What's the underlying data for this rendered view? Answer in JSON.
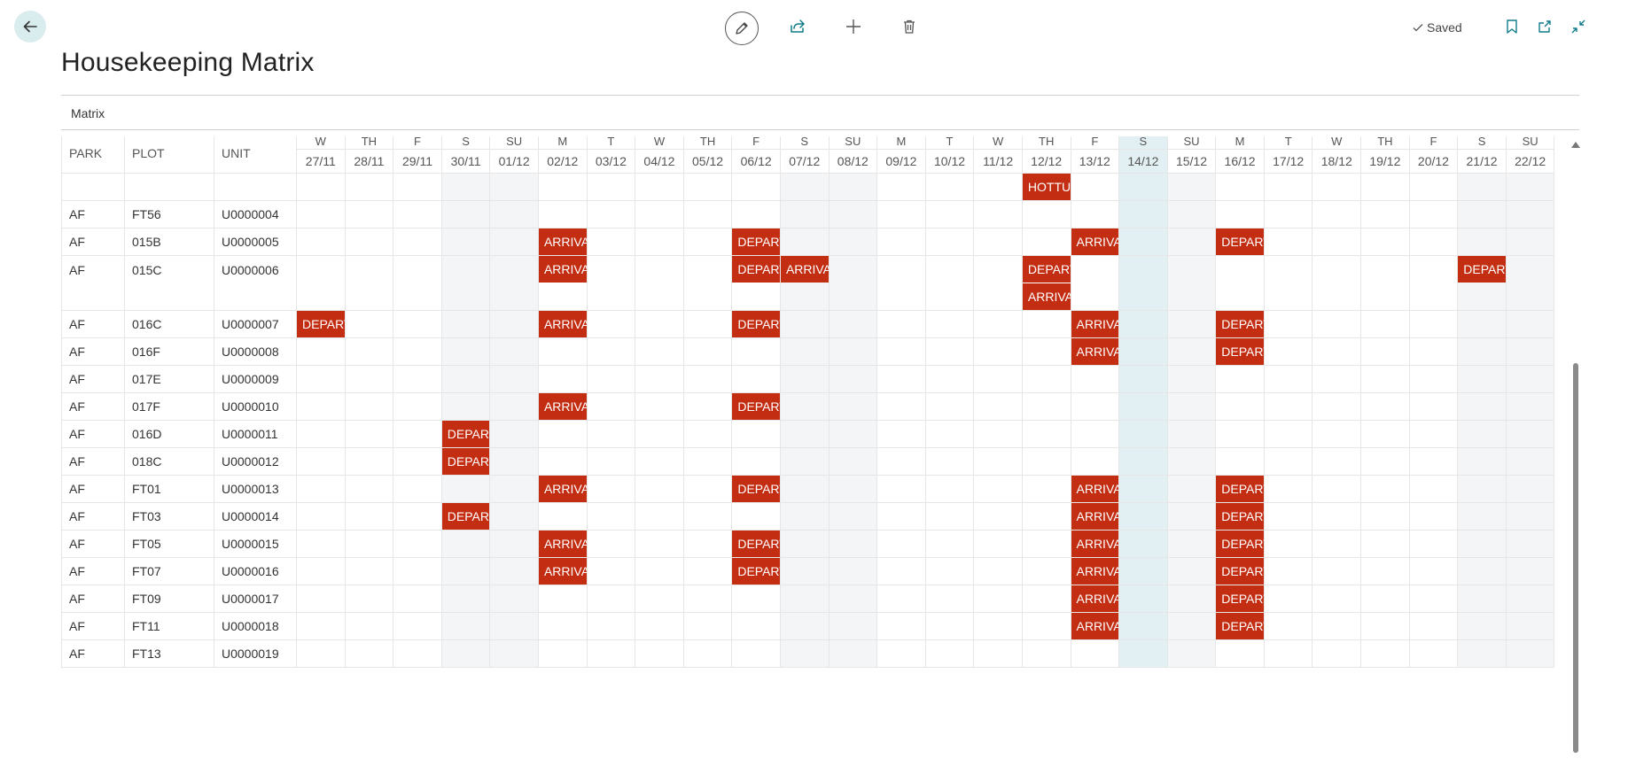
{
  "page": {
    "title": "Housekeeping Matrix",
    "section": "Matrix",
    "status": "Saved"
  },
  "toolbar": {
    "icons": [
      "back-arrow-icon",
      "pencil-icon",
      "share-icon",
      "plus-icon",
      "trash-icon",
      "checkmark-icon",
      "bookmark-icon",
      "open-new-window-icon",
      "collapse-icon"
    ]
  },
  "columns": {
    "park": "PARK",
    "plot": "PLOT",
    "unit": "UNIT"
  },
  "days": [
    {
      "dow": "W",
      "date": "27/11",
      "weekend": false
    },
    {
      "dow": "TH",
      "date": "28/11",
      "weekend": false
    },
    {
      "dow": "F",
      "date": "29/11",
      "weekend": false
    },
    {
      "dow": "S",
      "date": "30/11",
      "weekend": true
    },
    {
      "dow": "SU",
      "date": "01/12",
      "weekend": true
    },
    {
      "dow": "M",
      "date": "02/12",
      "weekend": false
    },
    {
      "dow": "T",
      "date": "03/12",
      "weekend": false
    },
    {
      "dow": "W",
      "date": "04/12",
      "weekend": false
    },
    {
      "dow": "TH",
      "date": "05/12",
      "weekend": false
    },
    {
      "dow": "F",
      "date": "06/12",
      "weekend": false
    },
    {
      "dow": "S",
      "date": "07/12",
      "weekend": true
    },
    {
      "dow": "SU",
      "date": "08/12",
      "weekend": true
    },
    {
      "dow": "M",
      "date": "09/12",
      "weekend": false
    },
    {
      "dow": "T",
      "date": "10/12",
      "weekend": false
    },
    {
      "dow": "W",
      "date": "11/12",
      "weekend": false
    },
    {
      "dow": "TH",
      "date": "12/12",
      "weekend": false
    },
    {
      "dow": "F",
      "date": "13/12",
      "weekend": false
    },
    {
      "dow": "S",
      "date": "14/12",
      "weekend": true,
      "today": true
    },
    {
      "dow": "SU",
      "date": "15/12",
      "weekend": true
    },
    {
      "dow": "M",
      "date": "16/12",
      "weekend": false
    },
    {
      "dow": "T",
      "date": "17/12",
      "weekend": false
    },
    {
      "dow": "W",
      "date": "18/12",
      "weekend": false
    },
    {
      "dow": "TH",
      "date": "19/12",
      "weekend": false
    },
    {
      "dow": "F",
      "date": "20/12",
      "weekend": false
    },
    {
      "dow": "S",
      "date": "21/12",
      "weekend": true
    },
    {
      "dow": "SU",
      "date": "22/12",
      "weekend": true
    }
  ],
  "rows": [
    {
      "park": "",
      "plot": "",
      "unit": "",
      "events": {
        "15": [
          "HOTTU"
        ]
      }
    },
    {
      "park": "AF",
      "plot": "FT56",
      "unit": "U0000004",
      "events": {}
    },
    {
      "park": "AF",
      "plot": "015B",
      "unit": "U0000005",
      "events": {
        "5": [
          "ARRIVA"
        ],
        "9": [
          "DEPART"
        ],
        "16": [
          "ARRIVA"
        ],
        "19": [
          "DEPART"
        ]
      }
    },
    {
      "park": "AF",
      "plot": "015C",
      "unit": "U0000006",
      "events": {
        "5": [
          "ARRIVA"
        ],
        "9": [
          "DEPART"
        ],
        "10": [
          "ARRIVA"
        ],
        "15": [
          "DEPART",
          "ARRIVA"
        ],
        "24": [
          "DEPART"
        ]
      }
    },
    {
      "park": "AF",
      "plot": "016C",
      "unit": "U0000007",
      "events": {
        "0": [
          "DEPART"
        ],
        "5": [
          "ARRIVA"
        ],
        "9": [
          "DEPART"
        ],
        "16": [
          "ARRIVA"
        ],
        "19": [
          "DEPART"
        ]
      }
    },
    {
      "park": "AF",
      "plot": "016F",
      "unit": "U0000008",
      "events": {
        "16": [
          "ARRIVA"
        ],
        "19": [
          "DEPART"
        ]
      }
    },
    {
      "park": "AF",
      "plot": "017E",
      "unit": "U0000009",
      "events": {}
    },
    {
      "park": "AF",
      "plot": "017F",
      "unit": "U0000010",
      "events": {
        "5": [
          "ARRIVA"
        ],
        "9": [
          "DEPART"
        ]
      }
    },
    {
      "park": "AF",
      "plot": "016D",
      "unit": "U0000011",
      "events": {
        "3": [
          "DEPART"
        ]
      }
    },
    {
      "park": "AF",
      "plot": "018C",
      "unit": "U0000012",
      "events": {
        "3": [
          "DEPART"
        ]
      }
    },
    {
      "park": "AF",
      "plot": "FT01",
      "unit": "U0000013",
      "events": {
        "5": [
          "ARRIVA"
        ],
        "9": [
          "DEPART"
        ],
        "16": [
          "ARRIVA"
        ],
        "19": [
          "DEPART"
        ]
      }
    },
    {
      "park": "AF",
      "plot": "FT03",
      "unit": "U0000014",
      "events": {
        "3": [
          "DEPART"
        ],
        "16": [
          "ARRIVA"
        ],
        "19": [
          "DEPART"
        ]
      }
    },
    {
      "park": "AF",
      "plot": "FT05",
      "unit": "U0000015",
      "events": {
        "5": [
          "ARRIVA"
        ],
        "9": [
          "DEPART"
        ],
        "16": [
          "ARRIVA"
        ],
        "19": [
          "DEPART"
        ]
      }
    },
    {
      "park": "AF",
      "plot": "FT07",
      "unit": "U0000016",
      "events": {
        "5": [
          "ARRIVA"
        ],
        "9": [
          "DEPART"
        ],
        "16": [
          "ARRIVA"
        ],
        "19": [
          "DEPART"
        ]
      }
    },
    {
      "park": "AF",
      "plot": "FT09",
      "unit": "U0000017",
      "events": {
        "16": [
          "ARRIVA"
        ],
        "19": [
          "DEPART"
        ]
      }
    },
    {
      "park": "AF",
      "plot": "FT11",
      "unit": "U0000018",
      "events": {
        "16": [
          "ARRIVA"
        ],
        "19": [
          "DEPART"
        ]
      }
    },
    {
      "park": "AF",
      "plot": "FT13",
      "unit": "U0000019",
      "events": {}
    }
  ],
  "colors": {
    "event": "#c32d12",
    "weekend": "#f4f5f7",
    "today": "#e3f0f3",
    "accent": "#0f7b8a"
  }
}
